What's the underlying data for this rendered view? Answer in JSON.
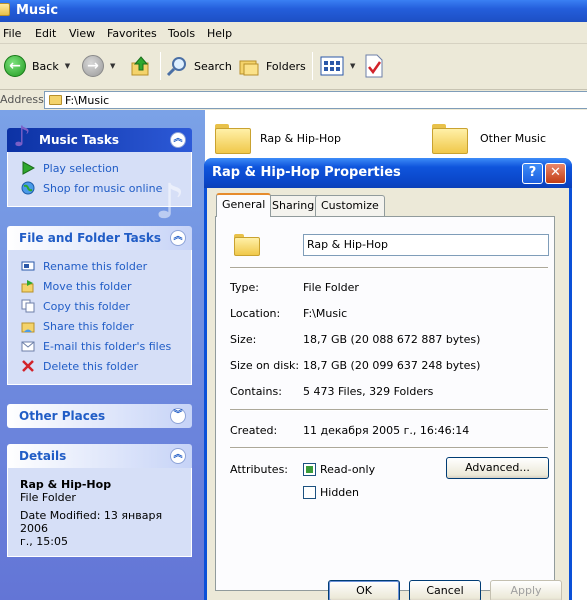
{
  "window": {
    "title": "Music"
  },
  "menu": [
    "File",
    "Edit",
    "View",
    "Favorites",
    "Tools",
    "Help"
  ],
  "toolbar": {
    "back": "Back",
    "search": "Search",
    "folders": "Folders"
  },
  "address": {
    "label": "Address",
    "path": "F:\\Music"
  },
  "left": {
    "music_tasks": {
      "title": "Music Tasks",
      "items": [
        "Play selection",
        "Shop for music online"
      ]
    },
    "file_tasks": {
      "title": "File and Folder Tasks",
      "items": [
        "Rename this folder",
        "Move this folder",
        "Copy this folder",
        "Share this folder",
        "E-mail this folder's files",
        "Delete this folder"
      ]
    },
    "other_places": {
      "title": "Other Places"
    },
    "details": {
      "title": "Details",
      "name": "Rap & Hip-Hop",
      "type": "File Folder",
      "modified_1": "Date Modified: 13 января 2006",
      "modified_2": "г., 15:05"
    }
  },
  "folders": [
    "Rap & Hip-Hop",
    "Other Music"
  ],
  "dialog": {
    "title": "Rap & Hip-Hop Properties",
    "help": "?",
    "close": "✕",
    "tabs": [
      "General",
      "Sharing",
      "Customize"
    ],
    "name_value": "Rap & Hip-Hop",
    "props": {
      "type_label": "Type:",
      "type_value": "File Folder",
      "location_label": "Location:",
      "location_value": "F:\\Music",
      "size_label": "Size:",
      "size_value": "18,7 GB (20 088 672 887 bytes)",
      "disk_label": "Size on disk:",
      "disk_value": "18,7 GB (20 099 637 248 bytes)",
      "contains_label": "Contains:",
      "contains_value": "5 473 Files, 329 Folders",
      "created_label": "Created:",
      "created_value": "11 декабря 2005 г., 16:46:14",
      "attributes_label": "Attributes:",
      "readonly_label": "Read-only",
      "hidden_label": "Hidden",
      "advanced_label": "Advanced..."
    },
    "buttons": {
      "ok": "OK",
      "cancel": "Cancel",
      "apply": "Apply"
    }
  }
}
